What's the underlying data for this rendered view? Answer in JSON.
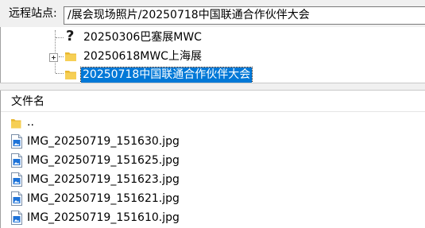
{
  "site_bar": {
    "label": "远程站点:",
    "path": "/展会现场照片/20250718中国联通合作伙伴大会"
  },
  "tree": {
    "items": [
      {
        "label": "20250306巴塞展MWC",
        "icon": "question-icon",
        "selected": false
      },
      {
        "label": "20250618MWC上海展",
        "icon": "folder-icon",
        "selected": false
      },
      {
        "label": "20250718中国联通合作伙伴大会",
        "icon": "folder-icon",
        "selected": true
      }
    ]
  },
  "file_list": {
    "column_header": "文件名",
    "rows": [
      {
        "name": "..",
        "icon": "folder-icon"
      },
      {
        "name": "IMG_20250719_151630.jpg",
        "icon": "image-file-icon"
      },
      {
        "name": "IMG_20250719_151625.jpg",
        "icon": "image-file-icon"
      },
      {
        "name": "IMG_20250719_151623.jpg",
        "icon": "image-file-icon"
      },
      {
        "name": "IMG_20250719_151621.jpg",
        "icon": "image-file-icon"
      },
      {
        "name": "IMG_20250719_151610.jpg",
        "icon": "image-file-icon"
      }
    ]
  },
  "colors": {
    "selection": "#0078d7",
    "folder": "#f4c542",
    "image_icon": "#1e73d8"
  }
}
